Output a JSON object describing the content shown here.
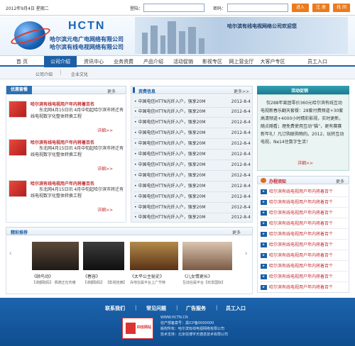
{
  "topbar": {
    "date": "2012年9月4日  星期二",
    "login_label": "登陆：",
    "password_label": "密码：",
    "enter": "进入",
    "register": "注 册",
    "retrieve": "找 回"
  },
  "header": {
    "logo_text": "HCTN",
    "logo_cn1": "哈尔滨元电广电网络有限公司",
    "logo_cn2": "哈尔滨有线电视网络有限公司",
    "welcome": "哈尔滨有线电视网络公司欢迎您"
  },
  "nav": {
    "items": [
      "首  页",
      "公司介绍",
      "资讯中心",
      "业务资费",
      "产品介绍",
      "活动促销",
      "影视专区",
      "网上营业厅",
      "大客户专区",
      "员工入口"
    ]
  },
  "subnav": {
    "items": [
      "公司介绍",
      "企业文化"
    ]
  },
  "promo": {
    "title": "优惠套餐",
    "more": "更多",
    "items": [
      {
        "title": "哈尔滨有线电视用户年内将着百名",
        "text": "东北网4月15日讯 4月中旬起哈尔滨市将迁有线电视数字化整体转换工程",
        "detail": "详细>>"
      },
      {
        "title": "哈尔滨有线电视用户年内将着百名",
        "text": "东北网4月15日讯 4月中旬起哈尔滨市将迁有线电视数字化整体转换工程",
        "detail": "详细>>"
      },
      {
        "title": "哈尔滨有线电视用户年内将着百名",
        "text": "东北网4月15日讯 4月中旬起哈尔滨市将迁有线电视数字化整体转换工程",
        "detail": "详细>>"
      }
    ]
  },
  "news": {
    "title": "资费信息",
    "more": "更多>>",
    "items": [
      {
        "text": "中国电信HTTN光纤入户，强享20M",
        "date": "2012-8-4"
      },
      {
        "text": "中国电信HTTN光纤入户，强享20M",
        "date": "2012-8-4"
      },
      {
        "text": "中国电信HTTN光纤入户，强享20M",
        "date": "2012-8-4"
      },
      {
        "text": "中国电信HTTN光纤入户，强享20M",
        "date": "2012-8-4"
      },
      {
        "text": "中国电信HTTN光纤入户，强享20M",
        "date": "2012-8-4"
      },
      {
        "text": "中国电信HTTN光纤入户，强享20M",
        "date": "2012-8-4"
      },
      {
        "text": "中国电信HTTN光纤入户，强享20M",
        "date": "2012-8-4"
      },
      {
        "text": "中国电信HTTN光纤入户，强享20M",
        "date": "2012-8-4"
      },
      {
        "text": "中国电信HTTN光纤入户，强享20M",
        "date": "2012-8-4"
      },
      {
        "text": "中国电信HTTN光纤入户，强享20M",
        "date": "2012-8-4"
      },
      {
        "text": "中国电信HTTN光纤入户，强享20M",
        "date": "2012-8-4"
      },
      {
        "text": "中国电信HTTN光纤入户，强享20M",
        "date": "2012-8-4"
      }
    ]
  },
  "activity": {
    "title": "活动促销",
    "text": "仅288年离团零价360元哈尔滨有线互动电视新春乐翻天套餐：28套付费频道+30套高清频道+4000小时精彩影视，实时更新，随点随看；理免费使用互动“猫”，更有赛赛新年礼！凡订购联购物的。2012，玩转互动电视，Ne14住数字生活！",
    "detail": "详细>>"
  },
  "ranking": {
    "title": "办程须知",
    "more": "更多",
    "items": [
      "哈尔滨有线电视用户年内将着百个",
      "哈尔滨有线电视用户年内将着百个",
      "哈尔滨有线电视用户年内将着百个",
      "哈尔滨有线电视用户年内将着百个",
      "哈尔滨有线电视用户年内将着百个",
      "哈尔滨有线电视用户年内将着百个",
      "哈尔滨有线电视用户年内将着百个",
      "哈尔滨有线电视用户年内将着百个",
      "哈尔滨有线电视用户年内将着百个",
      "哈尔滨有线电视用户年内将着百个"
    ]
  },
  "movies": {
    "title": "精彩推荐",
    "more": "更多",
    "items": [
      {
        "name": "《顾鸟动》",
        "desc": "【谍都取码】 佩德正在伤痛"
      },
      {
        "name": "《春容》",
        "desc": "【谍都取码】 【影视佳摘】"
      },
      {
        "name": "《太平公主秘史》",
        "desc": "兵地在属平台上广节特"
      },
      {
        "name": "《儿女情更长》",
        "desc": "互动在属平台【欢享国际】"
      }
    ]
  },
  "footer": {
    "links": [
      "联系我们",
      "常见问题",
      "广告服务",
      "员工入口"
    ],
    "site": "WWW.HCTN.CN",
    "lines": [
      "信产部备案号：黑ICP备0000000",
      "版权所有：哈尔滨有线电视网络有限公司",
      "技术支持：北京信博宇天德息技术有限公司"
    ],
    "badge": "四信网站"
  }
}
